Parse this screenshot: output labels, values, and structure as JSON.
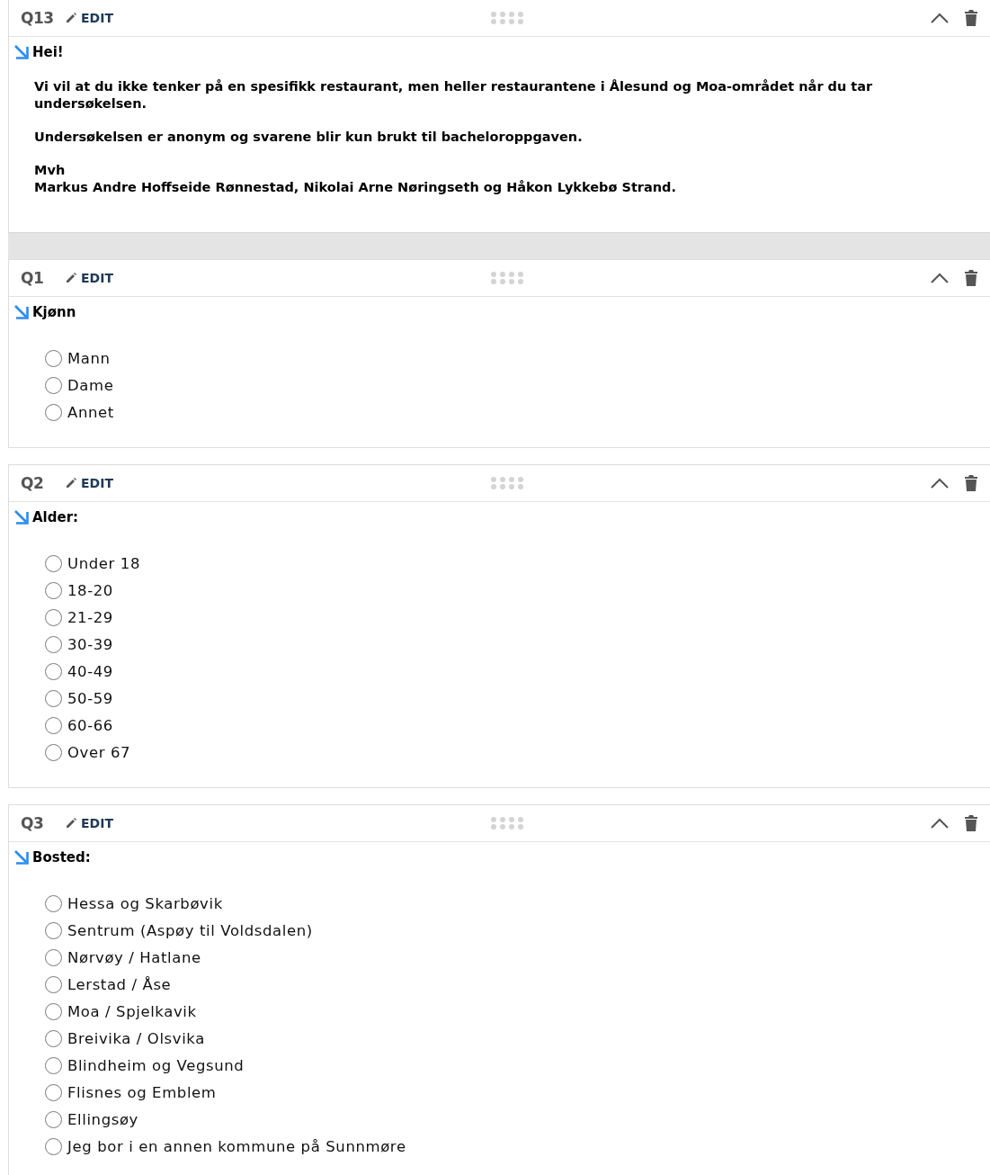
{
  "questions": [
    {
      "number": "Q13",
      "edit": "EDIT",
      "kind": "text",
      "title": "Hei!",
      "paragraphs": [
        {
          "lines": [
            "Vi vil at du ikke tenker på en spesifikk restaurant, men heller restaurantene i Ålesund og Moa-området når du tar undersøkelsen."
          ]
        },
        {
          "lines": [
            "Undersøkelsen er anonym og svarene blir kun brukt til bacheloroppgaven."
          ]
        },
        {
          "lines": [
            "Mvh",
            "Markus Andre Hoffseide Rønnestad, Nikolai Arne Nøringseth og Håkon Lykkebø Strand."
          ]
        }
      ]
    },
    {
      "number": "Q1",
      "edit": "EDIT",
      "kind": "radio",
      "title": "Kjønn",
      "options": [
        {
          "label": "Mann",
          "selected": false
        },
        {
          "label": "Dame",
          "selected": false
        },
        {
          "label": "Annet",
          "selected": false
        }
      ]
    },
    {
      "number": "Q2",
      "edit": "EDIT",
      "kind": "radio",
      "title": "Alder:",
      "options": [
        {
          "label": "Under 18",
          "selected": false
        },
        {
          "label": "18-20",
          "selected": false
        },
        {
          "label": "21-29",
          "selected": false
        },
        {
          "label": "30-39",
          "selected": false
        },
        {
          "label": "40-49",
          "selected": false
        },
        {
          "label": "50-59",
          "selected": false
        },
        {
          "label": "60-66",
          "selected": false
        },
        {
          "label": "Over 67",
          "selected": false
        }
      ]
    },
    {
      "number": "Q3",
      "edit": "EDIT",
      "kind": "radio",
      "title": "Bosted:",
      "options": [
        {
          "label": "Hessa og Skarbøvik",
          "selected": false
        },
        {
          "label": "Sentrum (Aspøy til Voldsdalen)",
          "selected": false
        },
        {
          "label": "Nørvøy / Hatlane",
          "selected": false
        },
        {
          "label": "Lerstad / Åse",
          "selected": false
        },
        {
          "label": "Moa / Spjelkavik",
          "selected": false
        },
        {
          "label": "Breivika / Olsvika",
          "selected": false
        },
        {
          "label": "Blindheim og Vegsund",
          "selected": false
        },
        {
          "label": "Flisnes og Emblem",
          "selected": false
        },
        {
          "label": "Ellingsøy",
          "selected": false
        },
        {
          "label": "Jeg bor i en annen kommune på Sunnmøre",
          "selected": false
        }
      ]
    }
  ]
}
